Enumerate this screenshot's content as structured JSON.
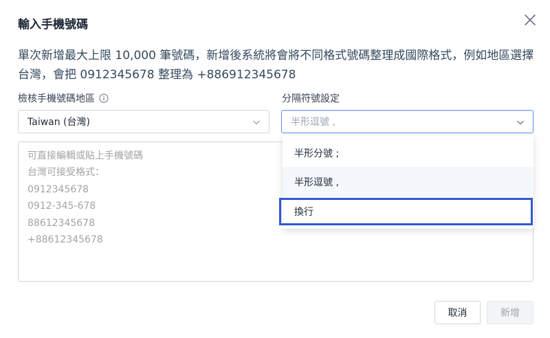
{
  "dialog": {
    "title": "輸入手機號碼",
    "description": "單次新增最大上限 10,000 筆號碼，新增後系統將會將不同格式號碼整理成國際格式，例如地區選擇台灣，會把 0912345678 整理為 +886912345678"
  },
  "region": {
    "label": "檢核手機號碼地區",
    "value": "Taiwan (台灣)"
  },
  "separator": {
    "label": "分隔符號設定",
    "placeholder": "半形逗號 ,",
    "options": [
      "半形分號 ;",
      "半形逗號 ,",
      "換行"
    ]
  },
  "textarea": {
    "placeholder_lines": [
      "可直接編輯或貼上手機號碼",
      "台灣可接受格式：",
      "0912345678",
      "0912-345-678",
      "88612345678",
      "+88612345678"
    ]
  },
  "buttons": {
    "cancel": "取消",
    "add": "新增"
  },
  "colors": {
    "accent": "#2e59d1",
    "focus_border": "#5b8def",
    "hover_bg": "#f4f7fb"
  }
}
